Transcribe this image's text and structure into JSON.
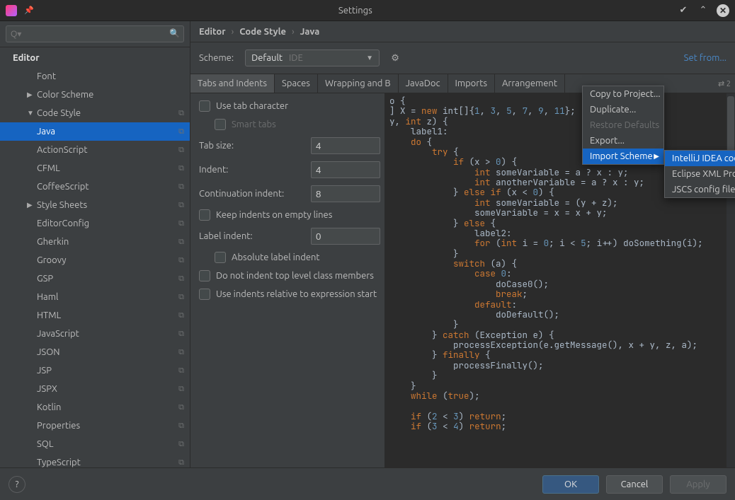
{
  "window": {
    "title": "Settings"
  },
  "search": {
    "placeholder": "Q▾"
  },
  "tree": {
    "root": "Editor",
    "font": "Font",
    "colorScheme": "Color Scheme",
    "codeStyle": "Code Style",
    "items": {
      "java": "Java",
      "actionscript": "ActionScript",
      "cfml": "CFML",
      "coffeescript": "CoffeeScript",
      "stylesheets": "Style Sheets",
      "editorconfig": "EditorConfig",
      "gherkin": "Gherkin",
      "groovy": "Groovy",
      "gsp": "GSP",
      "haml": "Haml",
      "html": "HTML",
      "javascript": "JavaScript",
      "json": "JSON",
      "jsp": "JSP",
      "jspx": "JSPX",
      "kotlin": "Kotlin",
      "properties": "Properties",
      "sql": "SQL",
      "typescript": "TypeScript"
    }
  },
  "breadcrumb": {
    "a": "Editor",
    "b": "Code Style",
    "c": "Java"
  },
  "scheme": {
    "label": "Scheme:",
    "value": "Default",
    "scope": "IDE"
  },
  "setFrom": "Set from...",
  "tabs": {
    "tabsIndents": "Tabs and Indents",
    "spaces": "Spaces",
    "wrapping": "Wrapping and B",
    "javadoc": "JavaDoc",
    "imports": "Imports",
    "arrangement": "Arrangement",
    "rightMarker": "⇄ 2"
  },
  "form": {
    "useTabChar": "Use tab character",
    "smartTabs": "Smart tabs",
    "tabSize": {
      "label": "Tab size:",
      "value": "4"
    },
    "indent": {
      "label": "Indent:",
      "value": "4"
    },
    "contIndent": {
      "label": "Continuation indent:",
      "value": "8"
    },
    "keepIndentsEmpty": "Keep indents on empty lines",
    "labelIndent": {
      "label": "Label indent:",
      "value": "0"
    },
    "absoluteLabelIndent": "Absolute label indent",
    "doNotIndentTopLevel": "Do not indent top level class members",
    "useIndentsRelative": "Use indents relative to expression start"
  },
  "gearMenu": {
    "copyToProject": "Copy to Project...",
    "duplicate": "Duplicate...",
    "restoreDefaults": "Restore Defaults",
    "export": "Export...",
    "importScheme": "Import Scheme",
    "sub": {
      "intellijXml": "IntelliJ IDEA code style XML",
      "eclipseXml": "Eclipse XML Profile",
      "jscs": "JSCS config file"
    }
  },
  "buttons": {
    "ok": "OK",
    "cancel": "Cancel",
    "apply": "Apply"
  },
  "code": {
    "l1a": "o {",
    "l2a": "] X = ",
    "l2b": " int[]{",
    "l2c": "};",
    "l3a": "y, ",
    "l3b": "int",
    "l3c": " z) {",
    "l4": "    label1:",
    "l5a": "    ",
    "l5kw": "do",
    "l5b": " {",
    "l6a": "        ",
    "l7a": "            ",
    "l7kw": "if",
    "l7b": " (x > ",
    "l7c": ") {",
    "l8a": "                ",
    "l8kw": "int",
    "l8b": " someVariable = a ? x : y;",
    "l9a": "                ",
    "l9kw": "int",
    "l9b": " anotherVariable = a ? x : y;",
    "l10a": "            } ",
    "l10kw1": "else if",
    "l10b": " (x < ",
    "l10c": ") {",
    "l11a": "                ",
    "l11kw": "int",
    "l11b": " someVariable = (y + z);",
    "l12a": "                someVariable = x = x + y;",
    "l13a": "            } ",
    "l13kw": "else",
    "l13b": " {",
    "l14": "                label2:",
    "l15a": "                ",
    "l15for": "for",
    "l15b": " (",
    "l15int": "int",
    "l15c": " i = ",
    "l15d": "; i < ",
    "l15e": "; i++) doSomething(i);",
    "l16": "            }",
    "l17a": "            ",
    "l17sw": "switch",
    "l17b": " (a) {",
    "l18a": "                ",
    "l18case": "case",
    "l18b": " ",
    "l19a": "                    doCase0();",
    "l20a": "                    ",
    "l20kw": "break",
    "l20b": ";",
    "l21a": "                ",
    "l21kw": "default",
    "l21b": ":",
    "l22": "                    doDefault();",
    "l23": "            }",
    "l24a": "        } ",
    "l24kw": "catch",
    "l24b": " (Exception e) {",
    "l25": "            processException(e.getMessage(), x + y, z, a);",
    "l26a": "        } ",
    "l26kw": "finally",
    "l26b": " {",
    "l27": "            processFinally();",
    "l28": "        }",
    "l29": "    }",
    "l30a": "    ",
    "l30kw": "while",
    "l30b": " (",
    "l30tr": "true",
    "l30c": ");",
    "l31": "",
    "l32a": "    ",
    "l32if": "if",
    "l32b": " (",
    "l32c": " < ",
    "l32d": ") ",
    "l32ret": "return",
    "l32e": ";",
    "l33a": "    ",
    "l33if": "if",
    "l33b": " (",
    "l33c": " < ",
    "l33d": ") ",
    "l33ret": "return",
    "l33e": ";",
    "n1": "1",
    "n3": "3",
    "n5": "5",
    "n7": "7",
    "n9": "9",
    "n11": "11",
    "n0": "0",
    "nz": "0",
    "ni": "0",
    "nf": "5",
    "n2": "2",
    "n3b": "3",
    "n4": "4"
  }
}
